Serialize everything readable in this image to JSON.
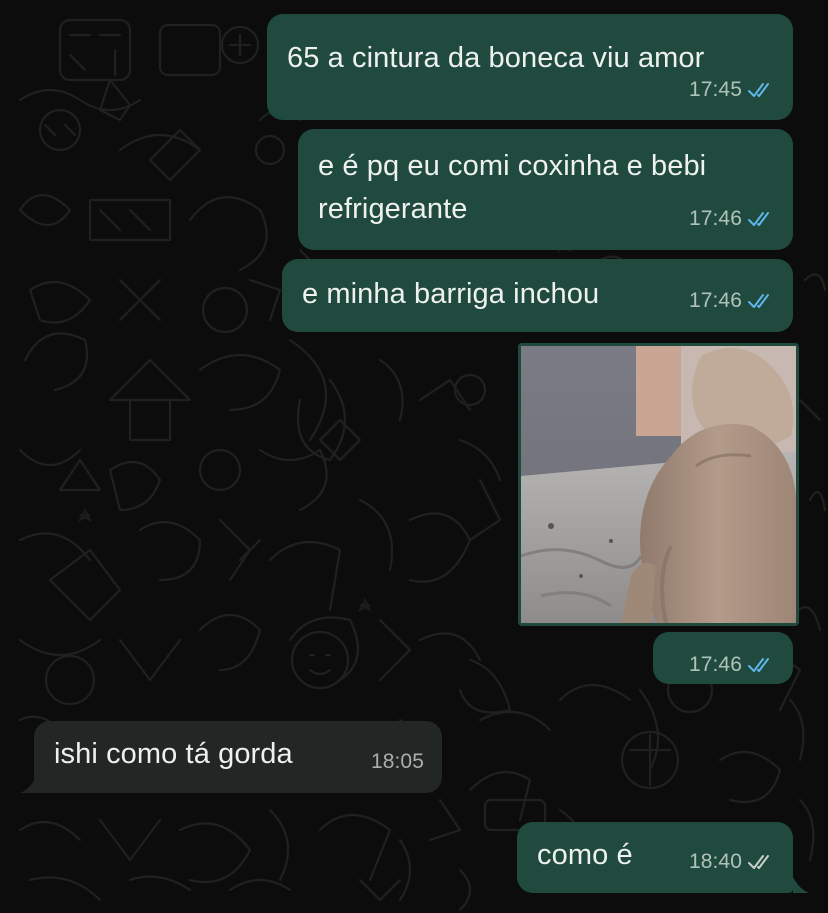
{
  "conversation": {
    "messages": [
      {
        "id": "m1",
        "direction": "outgoing",
        "text_lines": [
          "65 a cintura da boneca viu amor"
        ],
        "time": "17:45",
        "status": "read"
      },
      {
        "id": "m2",
        "direction": "outgoing",
        "text_lines": [
          "e é pq eu comi coxinha e bebi",
          "refrigerante"
        ],
        "time": "17:46",
        "status": "read"
      },
      {
        "id": "m3",
        "direction": "outgoing",
        "text_lines": [
          "e minha barriga inchou"
        ],
        "time": "17:46",
        "status": "read"
      },
      {
        "id": "m4",
        "direction": "outgoing",
        "type": "image",
        "time": "17:46",
        "status": "read"
      },
      {
        "id": "m5",
        "direction": "incoming",
        "text_lines": [
          "ishi como tá gorda"
        ],
        "time": "18:05"
      },
      {
        "id": "m6",
        "direction": "outgoing",
        "text_lines": [
          "como é"
        ],
        "time": "18:40",
        "status": "delivered"
      }
    ]
  },
  "colors": {
    "outgoing_bubble": "#1f4a3d",
    "incoming_bubble": "#222624",
    "read_ticks": "#5fb6e8",
    "delivered_ticks": "#c9d0cd",
    "background": "#0c0c0c"
  },
  "icons": {
    "read": "double-check-blue-icon",
    "delivered": "double-check-grey-icon"
  }
}
